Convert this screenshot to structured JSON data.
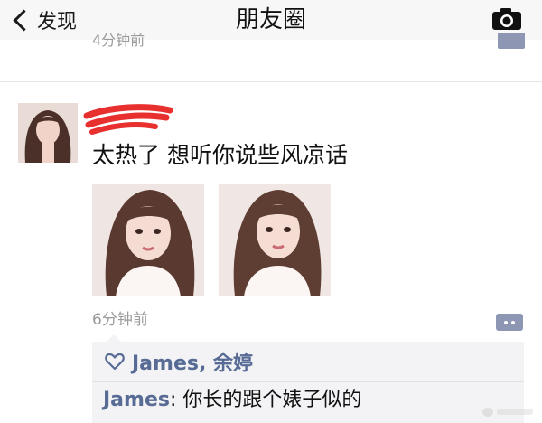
{
  "navbar": {
    "back_label": "发现",
    "title": "朋友圈",
    "camera_icon": "camera-icon"
  },
  "previous_post": {
    "time": "4分钟前"
  },
  "post": {
    "text": "太热了  想听你说些风凉话",
    "time": "6分钟前",
    "photo_count": 2
  },
  "likes": {
    "icon": "heart-outline-icon",
    "names": "James, 余婷"
  },
  "comments": [
    {
      "author": "James",
      "separator": ": ",
      "text": "你长的跟个婊子似的"
    }
  ],
  "colors": {
    "link_blue": "#576b95",
    "comment_button": "#8d97b3",
    "scribble_red": "#e8302f",
    "panel_bg": "#f3f3f5"
  }
}
